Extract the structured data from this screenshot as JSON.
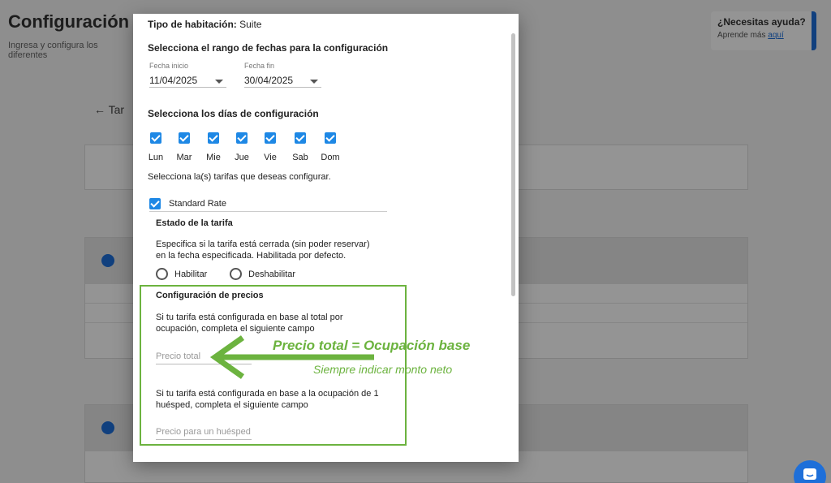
{
  "background": {
    "title": "Configuración",
    "subtitle": "Ingresa y configura los diferentes",
    "help": {
      "title": "¿Necesitas ayuda?",
      "text": "Aprende más",
      "link": "aquí"
    },
    "back_label": "Tar"
  },
  "modal": {
    "room_type_label": "Tipo de habitación:",
    "room_type_value": "Suite",
    "date_range_heading": "Selecciona el rango de fechas para la configuración",
    "start_date": {
      "label": "Fecha inicio",
      "value": "11/04/2025"
    },
    "end_date": {
      "label": "Fecha fin",
      "value": "30/04/2025"
    },
    "days_heading": "Selecciona los días de configuración",
    "days": [
      "Lun",
      "Mar",
      "Mie",
      "Jue",
      "Vie",
      "Sab",
      "Dom"
    ],
    "rates_heading": "Selecciona la(s) tarifas que deseas configurar.",
    "rate_name": "Standard Rate",
    "rate_state_heading": "Estado de la tarifa",
    "rate_state_desc_1": "Especifica si la tarifa está cerrada (sin poder reservar)",
    "rate_state_desc_2": "en la fecha especificada. Habilitada por defecto.",
    "enable_label": "Habilitar",
    "disable_label": "Deshabilitar",
    "price_heading": "Configuración de precios",
    "total_desc_1": "Si tu tarifa está configurada en base al total por",
    "total_desc_2": "ocupación, completa el siguiente campo",
    "total_placeholder": "Precio total",
    "single_desc_1": "Si tu tarifa está configurada en base a la ocupación de 1",
    "single_desc_2": "huésped, completa el siguiente campo",
    "single_placeholder": "Precio para un huésped"
  },
  "annotation": {
    "main": "Precio total = Ocupación base",
    "sub": "Siempre indicar monto neto",
    "color": "#6cb33f"
  },
  "colors": {
    "accent": "#1e88e5",
    "annotation": "#6cb33f"
  },
  "icons": [
    "checkbox-checked-icon",
    "caret-down-icon",
    "radio-empty-icon",
    "arrow-left-icon",
    "chat-icon",
    "back-arrow-icon"
  ]
}
